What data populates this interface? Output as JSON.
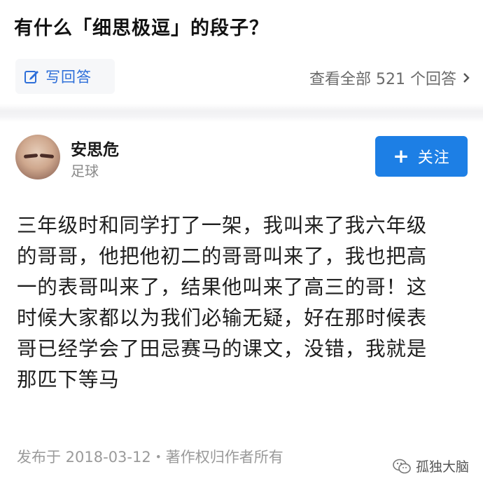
{
  "question": {
    "title": "有什么「细思极逗」的段子？"
  },
  "actions": {
    "write_answer": "写回答",
    "view_all": "查看全部 521 个回答"
  },
  "author": {
    "name": "安思危",
    "tag": "足球",
    "follow_label": "关注"
  },
  "answer": {
    "lines": [
      "三年级时和同学打了一架，我叫来了我六年级",
      "的哥哥，他把他初二的哥哥叫来了，我也把高",
      "一的表哥叫来了，结果他叫来了高三的哥！这",
      "时候大家都以为我们必输无疑，好在那时候表",
      "哥已经学会了田忌赛马的课文，没错，我就是",
      "那匹下等马"
    ]
  },
  "meta": {
    "published": "发布于 2018-03-12・著作权归作者所有"
  },
  "overlay": {
    "brand": "孤独大脑"
  },
  "colors": {
    "accent": "#1d7fe5",
    "link": "#2e6fd9",
    "muted": "#8a8a8a"
  },
  "icons": [
    "pen-square-icon",
    "chevron-right-icon",
    "plus-icon",
    "wechat-logo-icon"
  ]
}
